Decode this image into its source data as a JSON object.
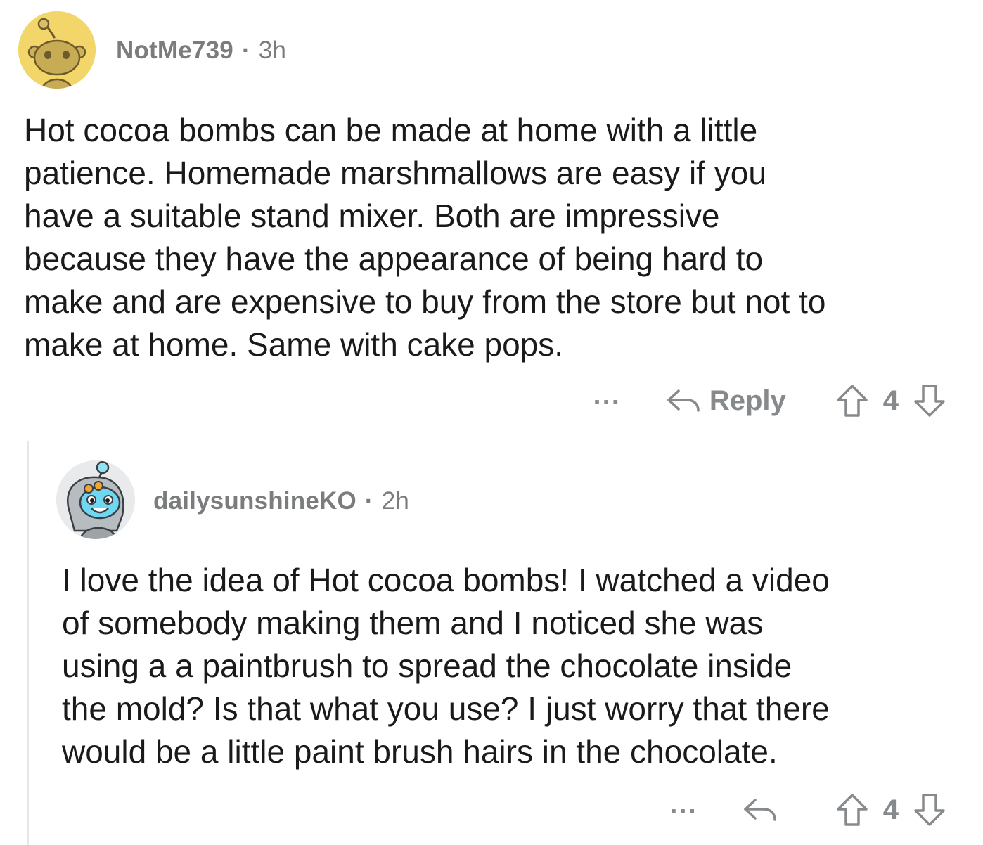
{
  "comments": [
    {
      "author": "NotMe739",
      "separator": "·",
      "age": "3h",
      "avatar_icon": "snoo-avatar-icon",
      "body": "Hot cocoa bombs can be made at home with a little\npatience.  Homemade marshmallows are easy if you\nhave a suitable stand mixer.  Both are impressive\nbecause they have the appearance of being hard to\nmake and are expensive to buy from the store but not to\nmake at home.  Same with cake pops.",
      "more_label": "...",
      "reply_label": "Reply",
      "score": "4",
      "colors": {
        "avatar_bg": "#f2d66a"
      }
    },
    {
      "author": "dailysunshineKO",
      "separator": "·",
      "age": "2h",
      "avatar_icon": "snoo-avatar-icon",
      "body": "I love the idea of Hot cocoa bombs! I watched a video\nof somebody making them and I noticed she was\nusing a a paintbrush to spread the chocolate inside\nthe mold? Is that what you use? I just worry that there\nwould be a little paint brush hairs in the chocolate.",
      "more_label": "...",
      "score": "4",
      "colors": {
        "avatar_bg": "#e8eaec",
        "accent": "#6fd8f0"
      }
    }
  ],
  "colors": {
    "meta_text": "#7a7c7e",
    "body_text": "#1a1a1b",
    "action_text": "#878a8c",
    "thread_line": "#e6e7e9"
  },
  "icons": [
    "reply-arrow-icon",
    "upvote-arrow-icon",
    "downvote-arrow-icon",
    "more-options-icon"
  ]
}
